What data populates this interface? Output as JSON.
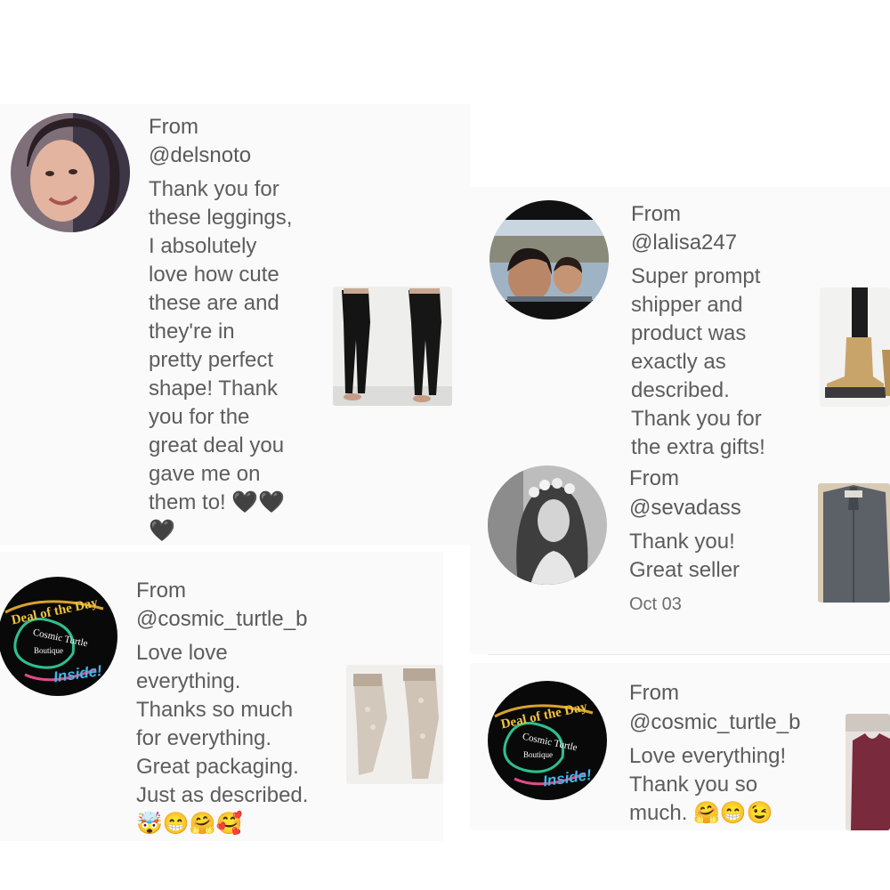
{
  "reviews": [
    {
      "from_label": "From",
      "handle": "@delsnoto",
      "message": "Thank you for\nthese leggings,\nI absolutely\nlove how cute\nthese are and\nthey're in\npretty perfect\nshape! Thank\nyou for the\ngreat deal you\ngave me on\nthem to! 🖤🖤\n🖤",
      "item_image": "black leggings photo"
    },
    {
      "from_label": "From",
      "handle": "@lalisa247",
      "message": "Super prompt\nshipper and\nproduct was\nexactly as\ndescribed.\nThank you for\nthe extra gifts!",
      "item_image": "winter boots photo"
    },
    {
      "from_label": "From",
      "handle": "@sevadass",
      "message": "Thank you!\nGreat seller",
      "date": "Oct 03",
      "item_image": "gray button shirt photo"
    },
    {
      "from_label": "From",
      "handle": "@cosmic_turtle_b",
      "message": "Love love\neverything.\nThanks so much\nfor everything.\nGreat packaging.\nJust as described.\n🤯😁🤗🥰",
      "item_image": "lace stockings photo"
    },
    {
      "from_label": "From",
      "handle": "@cosmic_turtle_b",
      "message": "Love everything!\nThank you so\nmuch. 🤗😁😉",
      "item_image": "maroon top photo"
    }
  ],
  "logo": {
    "line1": "Deal of the Day",
    "line2": "Cosmic Turtle",
    "line3": "Boutique",
    "line4": "Inside!"
  },
  "colors": {
    "card_bg": "#fafafa",
    "text": "#5d5d5d",
    "page_bg": "#ffffff"
  }
}
